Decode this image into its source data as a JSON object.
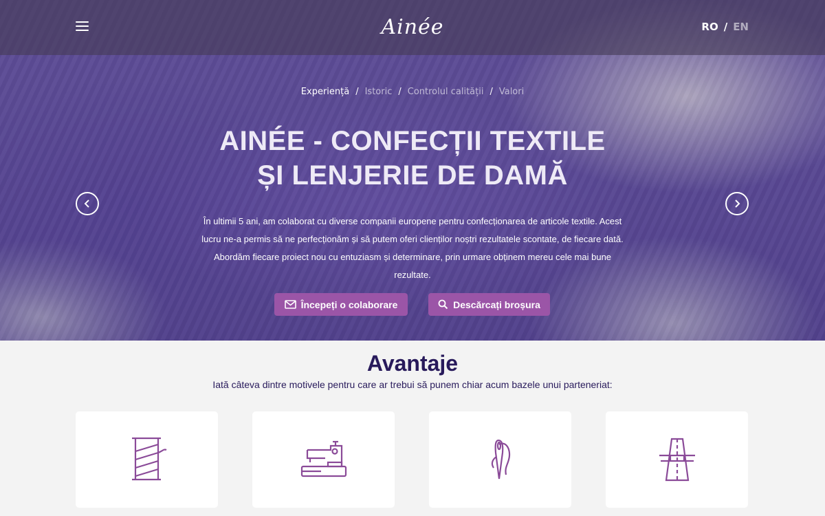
{
  "header": {
    "logo_text": "Ainée",
    "lang_active": "RO",
    "lang_separator": "/",
    "lang_other": "EN"
  },
  "breadcrumb": [
    {
      "label": "Experiență",
      "active": true
    },
    {
      "label": "Istoric",
      "active": false
    },
    {
      "label": "Controlul calității",
      "active": false
    },
    {
      "label": "Valori",
      "active": false
    }
  ],
  "breadcrumb_separator": "/",
  "hero": {
    "title_line1": "AINÉE - CONFECȚII TEXTILE",
    "title_line2": "ȘI LENJERIE DE DAMĂ",
    "text": "În ultimii 5 ani, am colaborat cu diverse companii europene pentru confecționarea de articole textile. Acest lucru ne-a permis să ne perfecționăm și să putem oferi clienților noștri rezultatele scontate, de fiecare dată. Abordăm fiecare proiect nou cu entuziasm și determinare, prin urmare obținem mereu cele mai bune rezultate.",
    "btn_collab": "Începeți o colaborare",
    "btn_brochure": "Descărcați broșura"
  },
  "advantages": {
    "title": "Avantaje",
    "subtitle": "Iată câteva dintre motivele pentru care ar trebui să punem chiar acum bazele unui parteneriat:"
  },
  "icons": {
    "menu": "menu-icon",
    "mail": "mail-icon",
    "search": "search-icon",
    "prev": "chevron-left-icon",
    "next": "chevron-right-icon",
    "cards": [
      "thread-spool-icon",
      "sewing-machine-icon",
      "needle-icon",
      "pattern-icon"
    ]
  },
  "colors": {
    "accent": "#9b55a7",
    "heading": "#281a5b",
    "icon_stroke": "#8a4a98"
  }
}
